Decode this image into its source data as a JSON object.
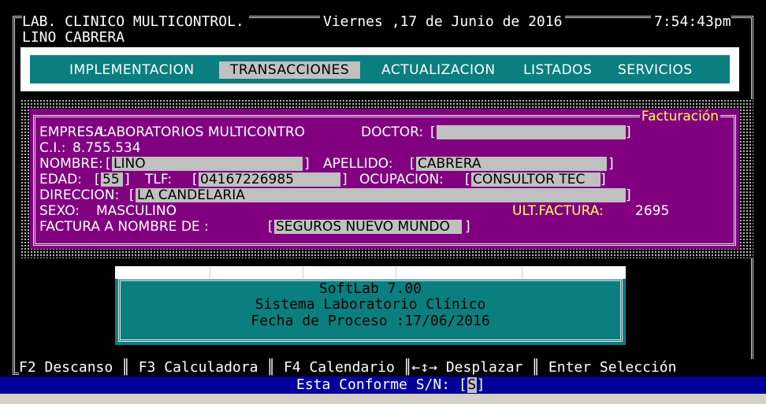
{
  "header": {
    "left_title": "LAB. CLINICO MULTICONTROL.",
    "date": "Viernes ,17 de Junio de 2016",
    "time": "7:54:43pm",
    "user": "LINO CABRERA"
  },
  "menu": {
    "items": [
      {
        "label": "IMPLEMENTACION"
      },
      {
        "label": "TRANSACCIONES",
        "active": true
      },
      {
        "label": "ACTUALIZACION"
      },
      {
        "label": "LISTADOS"
      },
      {
        "label": "SERVICIOS"
      }
    ]
  },
  "facturacion": {
    "title": "Facturación",
    "empresa_label": "EMPRESA:",
    "empresa_value": "LABORATORIOS MULTICONTRO",
    "doctor_label": "DOCTOR:",
    "doctor_value": "",
    "ci_label": "C.I.:",
    "ci_value": "8.755.534",
    "nombre_label": "NOMBRE:",
    "nombre_value": "LINO",
    "apellido_label": "APELLIDO:",
    "apellido_value": "CABRERA",
    "edad_label": "EDAD:",
    "edad_value": "55",
    "tlf_label": "TLF:",
    "tlf_value": "04167226985",
    "ocupacion_label": "OCUPACION:",
    "ocupacion_value": "CONSULTOR TEC",
    "direccion_label": "DIRECCION:",
    "direccion_value": "LA CANDELARIA",
    "sexo_label": "SEXO:",
    "sexo_value": "MASCULINO",
    "ult_factura_label": "ULT.FACTURA:",
    "ult_factura_value": "2695",
    "factura_nombre_label": "FACTURA A NOMBRE DE :",
    "factura_nombre_value": "SEGUROS NUEVO MUNDO"
  },
  "info": {
    "product": "SoftLab 7.00",
    "system": "Sistema Laboratorio Clínico",
    "process_date": "Fecha de Proceso :17/06/2016"
  },
  "function_keys": "F2 Descanso ║ F3 Calculadora ║ F4 Calendario ║←↕→ Desplazar ║ Enter Selección",
  "prompt": {
    "question": "Esta Conforme S/N: ",
    "answer": "S"
  },
  "colors": {
    "background": "#000000",
    "menu_teal": "#0b7f7f",
    "window_purple": "#800080",
    "field_gray": "#c0c0c0",
    "highlight_yellow": "#ffff55",
    "status_blue": "#000099"
  }
}
